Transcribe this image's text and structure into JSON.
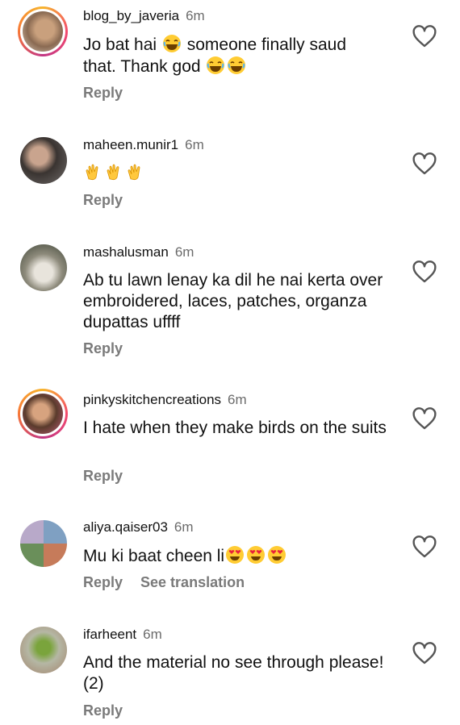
{
  "comments": [
    {
      "username": "blog_by_javeria",
      "time": "6m",
      "text_a": "Jo bat hai ",
      "text_b": " someone finally saud",
      "text_c": "that. Thank god ",
      "emoji_a": "laughing-emoji",
      "emoji_b": "laughing-emoji",
      "reply": "Reply"
    },
    {
      "username": "maheen.munir1",
      "time": "6m",
      "emoji": "clapping-hands-emoji",
      "reply": "Reply"
    },
    {
      "username": "mashalusman",
      "time": "6m",
      "text": "Ab tu lawn lenay ka dil he nai kerta over embroidered, laces, patches, organza dupattas uffff",
      "reply": "Reply"
    },
    {
      "username": "pinkyskitchencreations",
      "time": "6m",
      "text": "I hate when they make birds on the suits",
      "reply": "Reply"
    },
    {
      "username": "aliya.qaiser03",
      "time": "6m",
      "text": "Mu ki baat cheen li",
      "emoji": "heart-eyes-emoji",
      "reply": "Reply",
      "see_translation": "See translation"
    },
    {
      "username": "ifarheent",
      "time": "6m",
      "text": "And the material no see through please! (2)",
      "reply": "Reply"
    }
  ],
  "icons": {
    "like": "heart-outline-icon"
  },
  "colors": {
    "text": "#111111",
    "muted": "#6b6b6b",
    "action": "#7a7a7a",
    "story_ring": "#e1306c"
  }
}
